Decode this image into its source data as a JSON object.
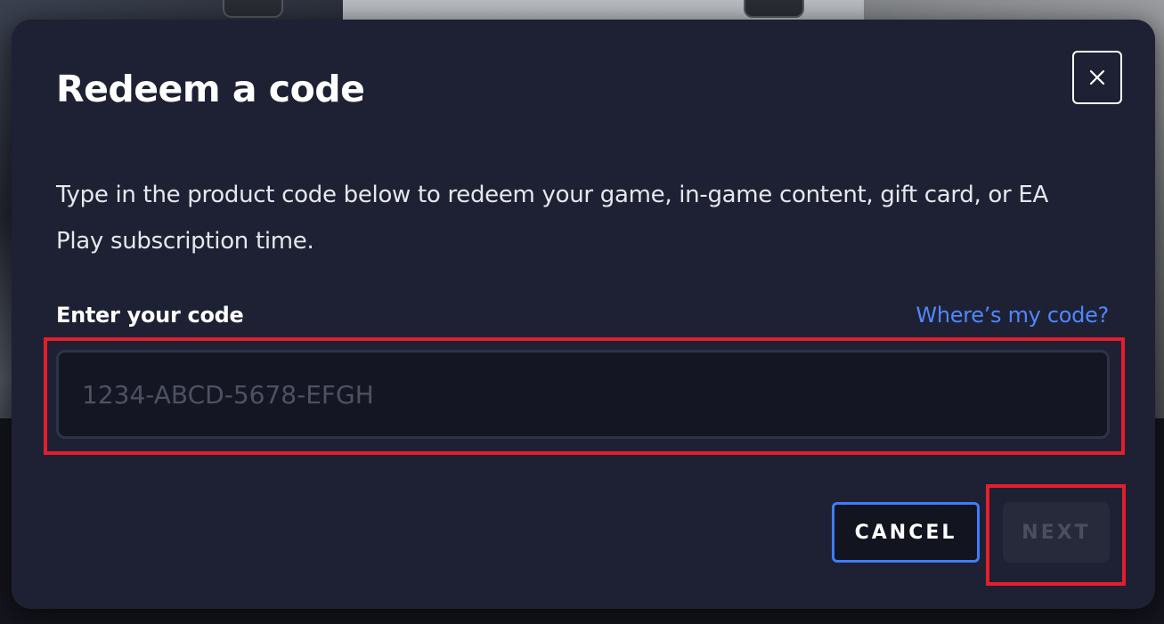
{
  "dialog": {
    "title": "Redeem a code",
    "description": "Type in the product code below to redeem your game, in-game content, gift card, or EA Play subscription time.",
    "close_icon": "close-icon"
  },
  "code_field": {
    "label": "Enter your code",
    "help_link": "Where’s my code?",
    "value": "",
    "placeholder": "1234-ABCD-5678-EFGH"
  },
  "actions": {
    "cancel_label": "CANCEL",
    "next_label": "NEXT",
    "next_disabled": true
  },
  "colors": {
    "dialog_bg": "#1e2133",
    "accent_link": "#4f87ff",
    "cancel_border": "#3f7cff",
    "highlight_red": "#e41e2b"
  }
}
